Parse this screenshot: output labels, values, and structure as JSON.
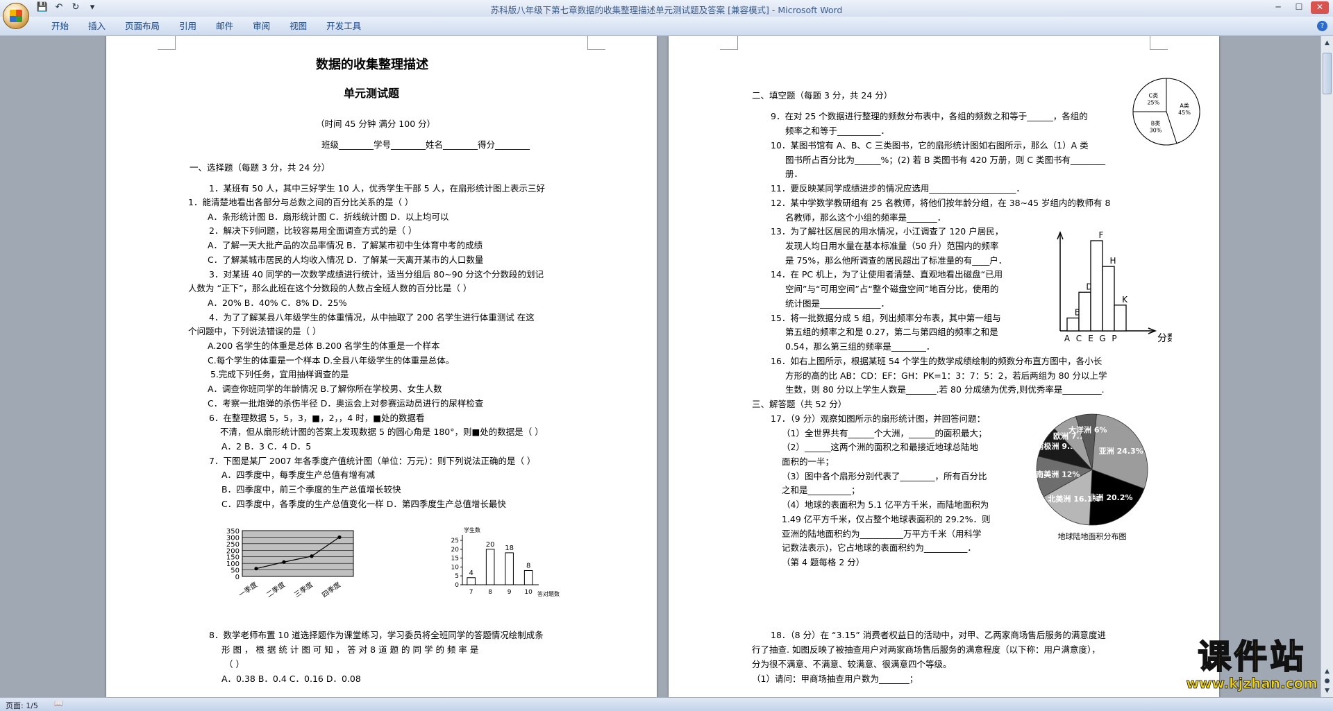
{
  "window": {
    "title": "苏科版八年级下第七章数据的收集整理描述单元测试题及答案 [兼容模式] - Microsoft Word"
  },
  "ribbon": {
    "tabs": [
      "开始",
      "插入",
      "页面布局",
      "引用",
      "邮件",
      "审阅",
      "视图",
      "开发工具"
    ]
  },
  "status": {
    "page": "页面: 1/5"
  },
  "watermark": {
    "main": "课件站",
    "url": "www.kjzhan.com"
  },
  "page1": {
    "title": "数据的收集整理描述",
    "subtitle": "单元测试题",
    "time": "（时间 45 分钟   满分 100 分）",
    "fields": "班级________学号________姓名________得分________",
    "sec1": "一、选择题（每题 3 分，共 24 分）",
    "q1a": "1．某班有 50 人，其中三好学生 10 人，优秀学生干部 5 人，在扇形统计图上表示三好",
    "q1b": "1．能清楚地看出各部分与总数之间的百分比关系的是（      ）",
    "q1c": "A．条形统计图          B．扇形统计图        C．折线统计图          D．以上均可以",
    "q2a": "2．解决下列问题，比较容易用全面调查方式的是（              ）",
    "q2b": "A．了解一天大批产品的次品率情况     B．了解某市初中生体育中考的成绩",
    "q2c": "C．了解某城市居民的人均收入情况     D．了解某一天离开某市的人口数量",
    "q3a": "3．对某班 40 同学的一次数学成绩进行统计，适当分组后 80~90 分这个分数段的划记",
    "q3b": "人数为 “正下”，那么此班在这个分数段的人数占全班人数的百分比是（          ）",
    "q3c": "A．20%      B．40%              C．8%     D．25%",
    "q4a": "4．为了了解某县八年级学生的体重情况，从中抽取了 200 名学生进行体重测试  在这",
    "q4b": "个问题中，下列说法错误的是（      ）",
    "q4c": "A.200 名学生的体重是总体          B.200 名学生的体重是一个样本",
    "q4d": "C.每个学生的体重是一个样本        D.全县八年级学生的体重是总体。",
    "q5a": "5.完成下列任务，宜用抽样调查的是",
    "q5b": "A．调查你班同学的年龄情况                B.了解你所在学校男、女生人数",
    "q5c": "C．考察一批炮弹的杀伤半径                D．奥运会上对参赛运动员进行的尿样检查",
    "q6a": "6．在整理数据 5，5，3，■，2，，4 时，■处的数据看",
    "q6b": "不清，但从扇形统计图的答案上发现数据 5 的圆心角是 180°，则■处的数据是（     ）",
    "q6c": "A．2                  B．3                   C．4                  D．5",
    "q7a": "7．下图是某厂 2007 年各季度产值统计图（单位：万元）：则下列说法正确的是（      ）",
    "q7b": "A．四季度中，每季度生产总值有增有减",
    "q7c": "B．四季度中，前三个季度的生产总值增长较快",
    "q7d": "C．四季度中，各季度的生产总值变化一样         D．第四季度生产总值增长最快",
    "q8a": "8．数学老师布置 10 道选择题作为课堂练习，学习委员将全班同学的答题情况绘制成条",
    "q8b": "形 图 ， 根 据 统 计 图 可 知 ， 答 对  8  道 题 的 同 学 的 频 率 是",
    "q8c": "（      ）",
    "q8d": "A．0.38                  B．0.4                  C．0.16                  D．0.08"
  },
  "page2": {
    "sec2": "二、填空题（每题 3 分，共 24 分）",
    "q9a": "9．在对 25 个数据进行整理的频数分布表中，各组的频数之和等于______，各组的",
    "q9b": "频率之和等于__________．",
    "q10a": "10．某图书馆有 A、B、C 三类图书，它的扇形统计图如右图所示，那么（1）A 类",
    "q10b": "图书所占百分比为______%；(2) 若 B 类图书有 420 万册，则 C 类图书有________",
    "q10c": "册．",
    "q11": "11．要反映某同学成绩进步的情况应选用____________________．",
    "q12a": "12．某中学数学教研组有 25 名教师，将他们按年龄分组，在 38~45 岁组内的教师有 8",
    "q12b": "名教师，那么这个小组的频率是_______．",
    "q13a": "13．为了解社区居民的用水情况，小江调查了  120 户居民，",
    "q13b": "发现人均日用水量在基本标准量（50 升）范围内的频率",
    "q13c": "是 75%，那么他所调查的居民超出了标准量的有____户．",
    "q14a": "14．在 PC 机上，为了让使用者清楚、直观地看出磁盘“已用",
    "q14b": "空间”与“可用空间”占“整个磁盘空间”地百分比，使用的",
    "q14c": "统计图是______________．",
    "q15a": "15．将一批数据分成 5 组，列出频率分布表，其中第一组与",
    "q15b": "第五组的频率之和是  0.27，第二与第四组的频率之和是",
    "q15c": "0.54，那么第三组的频率是________．",
    "q16a": "16．如右上图所示，根据某班 54 个学生的数学成绩绘制的频数分布直方图中，各小长",
    "q16b": "方形的高的比 AB：CD：EF：GH：PK=1：3：7：5：2，若后两组为 80 分以上学",
    "q16c": "生数，则 80 分以上学生人数是_______.若 80 分成绩为优秀,则优秀率是_________.",
    "sec3": "三、解答题（共 52 分）",
    "q17a": "17．（9 分）观察如图所示的扇形统计图，并回答问题：",
    "q17b": "（1）全世界共有______个大洲，______的面积最大；",
    "q17c": "（2）______这两个洲的面积之和最接近地球总陆地",
    "q17d": "面积的一半；",
    "q17e": "（3）图中各个扇形分别代表了________，所有百分比",
    "q17f": "之和是__________；",
    "q17g": "（4）地球的表面积为 5.1 亿平方千米，而陆地面积为",
    "q17h": "1.49 亿平方千米，仅占整个地球表面积的 29.2%．则",
    "q17i": "亚洲的陆地面积约为__________万平方千米（用科学",
    "q17j": "记数法表示)，它占地球的表面积约为__________．",
    "q17k": "（第 4 题每格 2 分）",
    "q18a": "18．（8 分）在 “3.15” 消费者权益日的活动中，对甲、乙两家商场售后服务的满意度进",
    "q18b": "行了抽查. 如图反映了被抽查用户对两家商场售后服务的满意程度（以下称：用户满意度），",
    "q18c": "分为很不满意、不满意、较满意、很满意四个等级。",
    "q18d": "（1）请问：甲商场抽查用户数为_______；"
  },
  "chart_data": [
    {
      "type": "line",
      "title": "",
      "categories": [
        "一季度",
        "二季度",
        "三季度",
        "四季度"
      ],
      "values": [
        60,
        110,
        155,
        300
      ],
      "ylim": [
        0,
        350
      ],
      "yticks": [
        0,
        50,
        100,
        150,
        200,
        250,
        300,
        350
      ]
    },
    {
      "type": "bar",
      "ylabel": "学生数",
      "xlabel": "答对题数",
      "categories": [
        "7",
        "8",
        "9",
        "10"
      ],
      "values": [
        4,
        20,
        18,
        8
      ],
      "ylim": [
        0,
        25
      ],
      "yticks": [
        0,
        5,
        10,
        15,
        20,
        25
      ]
    },
    {
      "type": "pie",
      "labels": [
        "A类",
        "B类",
        "C类"
      ],
      "values": [
        45,
        30,
        25
      ],
      "label_text": [
        "A类 45%",
        "B类 30%",
        "C类 25%"
      ]
    },
    {
      "type": "bar",
      "title": "",
      "xlabel": "分数",
      "categories": [
        "AB",
        "CD",
        "EF",
        "GH",
        "PK"
      ],
      "point_labels": [
        "B",
        "D",
        "F",
        "H",
        "K"
      ],
      "tick_labels": [
        "A",
        "C",
        "E",
        "G",
        "P"
      ],
      "ratio": [
        1,
        3,
        7,
        5,
        2
      ]
    },
    {
      "type": "pie",
      "title": "地球陆地面积分布图",
      "labels": [
        "亚洲",
        "非洲",
        "北美洲",
        "南美洲",
        "南极洲",
        "欧洲",
        "大洋洲"
      ],
      "values": [
        29.3,
        20.2,
        16.1,
        12,
        9.3,
        7.1,
        6
      ],
      "label_text": [
        "亚洲 24.3%",
        "非洲 20.2%",
        "北美洲 16.1%",
        "南美洲 12%",
        "南极洲 9.3%",
        "欧洲 7.1%",
        "大洋洲 6%"
      ],
      "colors": [
        "#9c9c9c",
        "#000000",
        "#b7b7b7",
        "#6e6e6e",
        "#1a1a1a",
        "#a0a0a0",
        "#5a5a5a"
      ]
    }
  ]
}
